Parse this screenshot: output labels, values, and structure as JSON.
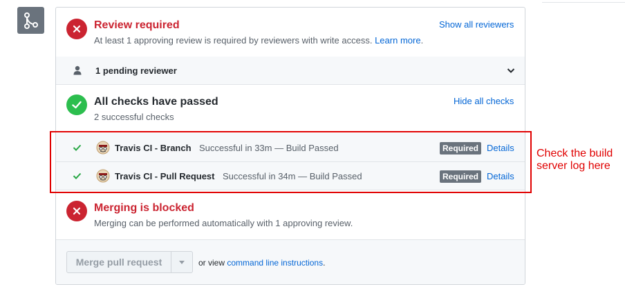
{
  "review": {
    "title": "Review required",
    "description": "At least 1 approving review is required by reviewers with write access.",
    "learn_more": "Learn more",
    "period": ".",
    "show_reviewers": "Show all reviewers"
  },
  "pending": {
    "label": "1 pending reviewer"
  },
  "checks": {
    "title": "All checks have passed",
    "subtitle": "2 successful checks",
    "hide_link": "Hide all checks",
    "items": [
      {
        "name": "Travis CI - Branch",
        "status": "Successful in 33m — Build Passed",
        "badge": "Required",
        "details": "Details"
      },
      {
        "name": "Travis CI - Pull Request",
        "status": "Successful in 34m — Build Passed",
        "badge": "Required",
        "details": "Details"
      }
    ]
  },
  "merge": {
    "title": "Merging is blocked",
    "description": "Merging can be performed automatically with 1 approving review.",
    "button": "Merge pull request",
    "or_view": "or view",
    "command_line": "command line instructions",
    "period": "."
  },
  "annotation": {
    "text": "Check the build server log here"
  },
  "colors": {
    "error": "#cb2431",
    "success": "#2cbe4e",
    "link": "#0366d6",
    "highlight": "#e00000"
  }
}
